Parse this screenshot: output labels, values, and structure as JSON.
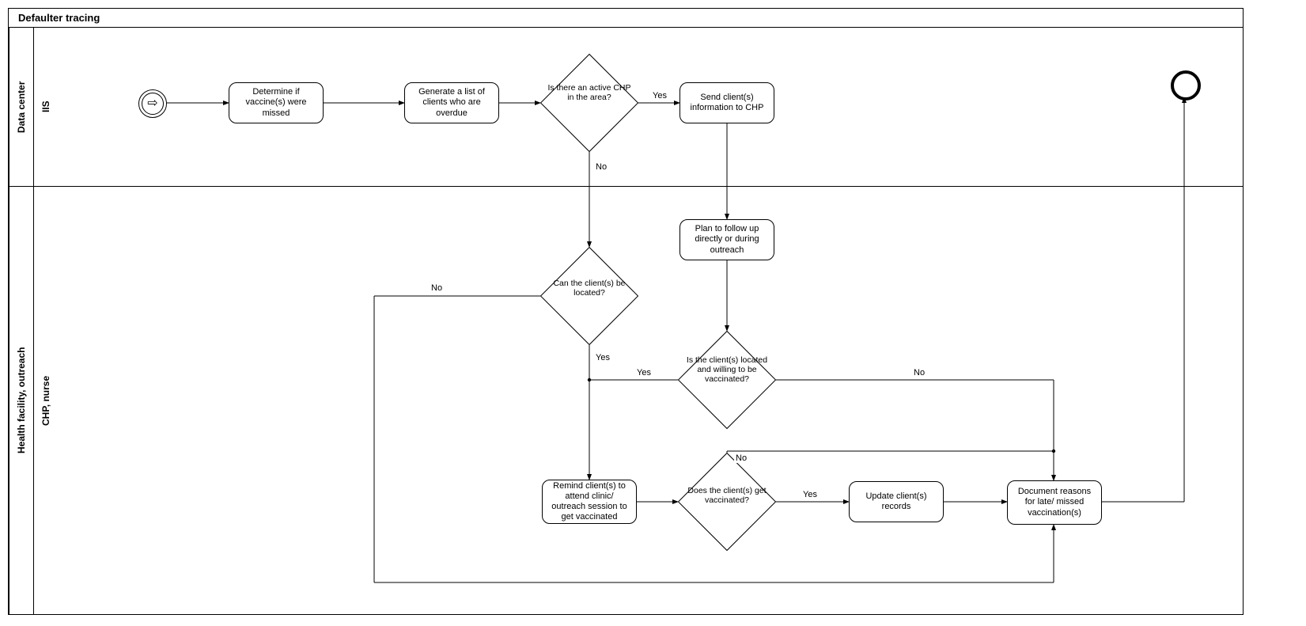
{
  "title": "Defaulter tracing",
  "lanes": {
    "data_center": {
      "outer": "Data center",
      "inner": "IIS"
    },
    "health": {
      "outer": "Health facility, outreach",
      "inner": "CHP, nurse"
    }
  },
  "nodes": {
    "determine": "Determine if vaccine(s) were missed",
    "generate": "Generate a list of clients who are overdue",
    "active_chp": "Is there an active CHP in the area?",
    "send_chp": "Send client(s) information to CHP",
    "plan_follow": "Plan to follow up directly or during outreach",
    "can_locate": "Can the client(s) be located?",
    "located_willing": "Is the client(s) located and willing to be vaccinated?",
    "remind": "Remind client(s) to attend clinic/ outreach session to get vaccinated",
    "get_vacc": "Does the client(s) get vaccinated?",
    "update": "Update client(s) records",
    "document": "Document reasons for late/ missed vaccination(s)"
  },
  "labels": {
    "yes": "Yes",
    "no": "No"
  }
}
